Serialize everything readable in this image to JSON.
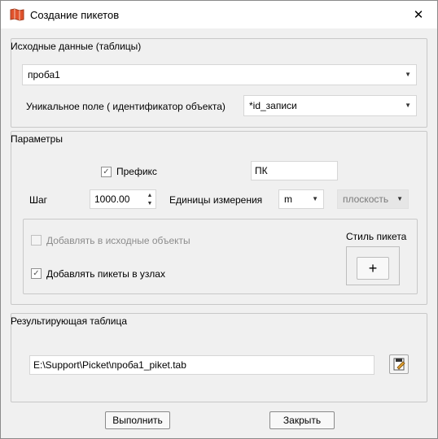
{
  "window": {
    "title": "Создание пикетов"
  },
  "source": {
    "legend": "Исходные данные (таблицы)",
    "table": "проба1",
    "unique_field_label": "Уникальное поле ( идентификатор объекта)",
    "unique_field": "*id_записи"
  },
  "params": {
    "legend": "Параметры",
    "prefix_label": "Префикс",
    "prefix_checked": true,
    "prefix_value": "ПК",
    "step_label": "Шаг",
    "step_value": "1000.00",
    "units_label": "Единицы измерения",
    "units_value": "m",
    "plane_value": "плоскость",
    "add_to_source_label": "Добавлять в исходные объекты",
    "add_to_source_checked": false,
    "add_at_nodes_label": "Добавлять пикеты в узлах",
    "add_at_nodes_checked": true,
    "style_label": "Стиль пикета",
    "style_button": "+"
  },
  "result": {
    "legend": "Результирующая таблица",
    "path": "E:\\Support\\Picket\\проба1_piket.tab"
  },
  "buttons": {
    "run": "Выполнить",
    "close": "Закрыть"
  },
  "icons": {
    "app": "map-book-icon",
    "close": "close-icon",
    "file": "file-edit-icon"
  },
  "colors": {
    "app_icon": "#e0522c",
    "window_bg": "#f0f0f0"
  }
}
